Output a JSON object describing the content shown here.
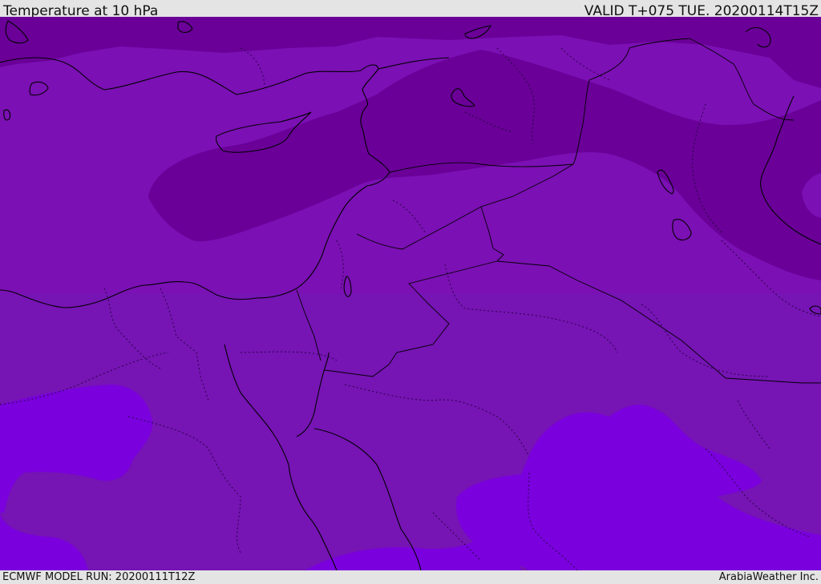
{
  "header": {
    "title": "Temperature at 10 hPa",
    "valid": "VALID T+075 TUE. 20200114T15Z"
  },
  "footer": {
    "model_run": "ECMWF MODEL RUN: 20200111T12Z",
    "credit": "ArabiaWeather Inc."
  },
  "map": {
    "field_colors": {
      "colder": "#6a0098",
      "mid": "#7b10b4",
      "lower": "#7614b4",
      "warmer": "#7a00dd"
    },
    "coastline_color": "#000000",
    "border_color": "#000000"
  }
}
